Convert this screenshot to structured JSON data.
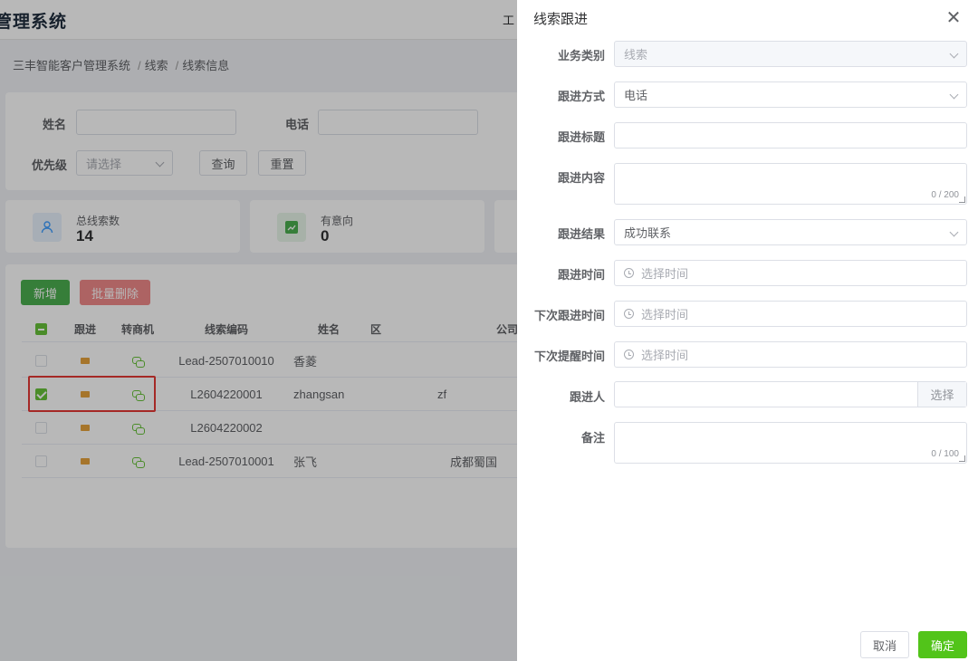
{
  "app": {
    "title": "管理系统",
    "topbar_item": "工"
  },
  "breadcrumb": [
    "三丰智能客户管理系统",
    "线索",
    "线索信息"
  ],
  "breadcrumb_sep": "/",
  "filter": {
    "name_label": "姓名",
    "phone_label": "电话",
    "priority_label": "优先级",
    "priority_placeholder": "请选择",
    "query_button": "查询",
    "reset_button": "重置"
  },
  "stats": [
    {
      "label": "总线索数",
      "value": "14",
      "icon": "user-icon",
      "color": "#409eff"
    },
    {
      "label": "有意向",
      "value": "0",
      "icon": "trend-chart-icon",
      "color": "#4caf50"
    }
  ],
  "toolbar": {
    "add_label": "新增",
    "batch_delete_label": "批量删除"
  },
  "table": {
    "headers": {
      "follow": "跟进",
      "convert": "转商机",
      "code": "线索编码",
      "name": "姓名",
      "region": "区",
      "company": "公司"
    },
    "rows": [
      {
        "code": "Lead-2507010010",
        "name": "香菱",
        "region": "",
        "checked": false
      },
      {
        "code": "L2604220001",
        "name": "zhangsan",
        "region": "zf",
        "checked": true
      },
      {
        "code": "L2604220002",
        "name": "",
        "region": "",
        "checked": false
      },
      {
        "code": "Lead-2507010001",
        "name": "张飞",
        "region": "成都蜀国",
        "checked": false
      }
    ]
  },
  "drawer": {
    "title": "线索跟进",
    "business_type": {
      "label": "业务类别",
      "value": "线索"
    },
    "follow_method": {
      "label": "跟进方式",
      "value": "电话"
    },
    "follow_title": {
      "label": "跟进标题",
      "value": ""
    },
    "follow_content": {
      "label": "跟进内容",
      "counter": "0 / 200"
    },
    "follow_result": {
      "label": "跟进结果",
      "value": "成功联系"
    },
    "follow_time": {
      "label": "跟进时间",
      "placeholder": "选择时间"
    },
    "next_follow_time": {
      "label": "下次跟进时间",
      "placeholder": "选择时间"
    },
    "next_remind_time": {
      "label": "下次提醒时间",
      "placeholder": "选择时间"
    },
    "follower": {
      "label": "跟进人",
      "select_button": "选择"
    },
    "remark": {
      "label": "备注",
      "counter": "0 / 100"
    },
    "cancel_button": "取消",
    "confirm_button": "确定"
  }
}
